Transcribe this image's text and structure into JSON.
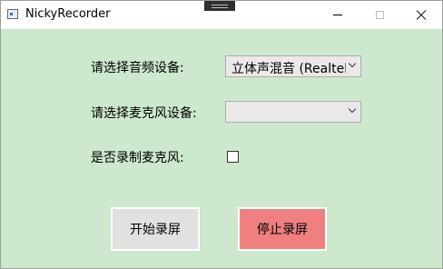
{
  "window": {
    "title": "NickyRecorder",
    "controls": {
      "minimize": "minimize",
      "maximize": "maximize",
      "close": "close"
    }
  },
  "form": {
    "audio_device_label": "请选择音频设备:",
    "audio_device_value": "立体声混音 (Realtek",
    "mic_device_label": "请选择麦克风设备:",
    "mic_device_value": "",
    "record_mic_label": "是否录制麦克风:",
    "record_mic_checked": false
  },
  "buttons": {
    "start_label": "开始录屏",
    "stop_label": "停止录屏"
  },
  "colors": {
    "window_background": "#cde8cd",
    "stop_button": "#f08080",
    "start_button": "#e1e1e1"
  }
}
